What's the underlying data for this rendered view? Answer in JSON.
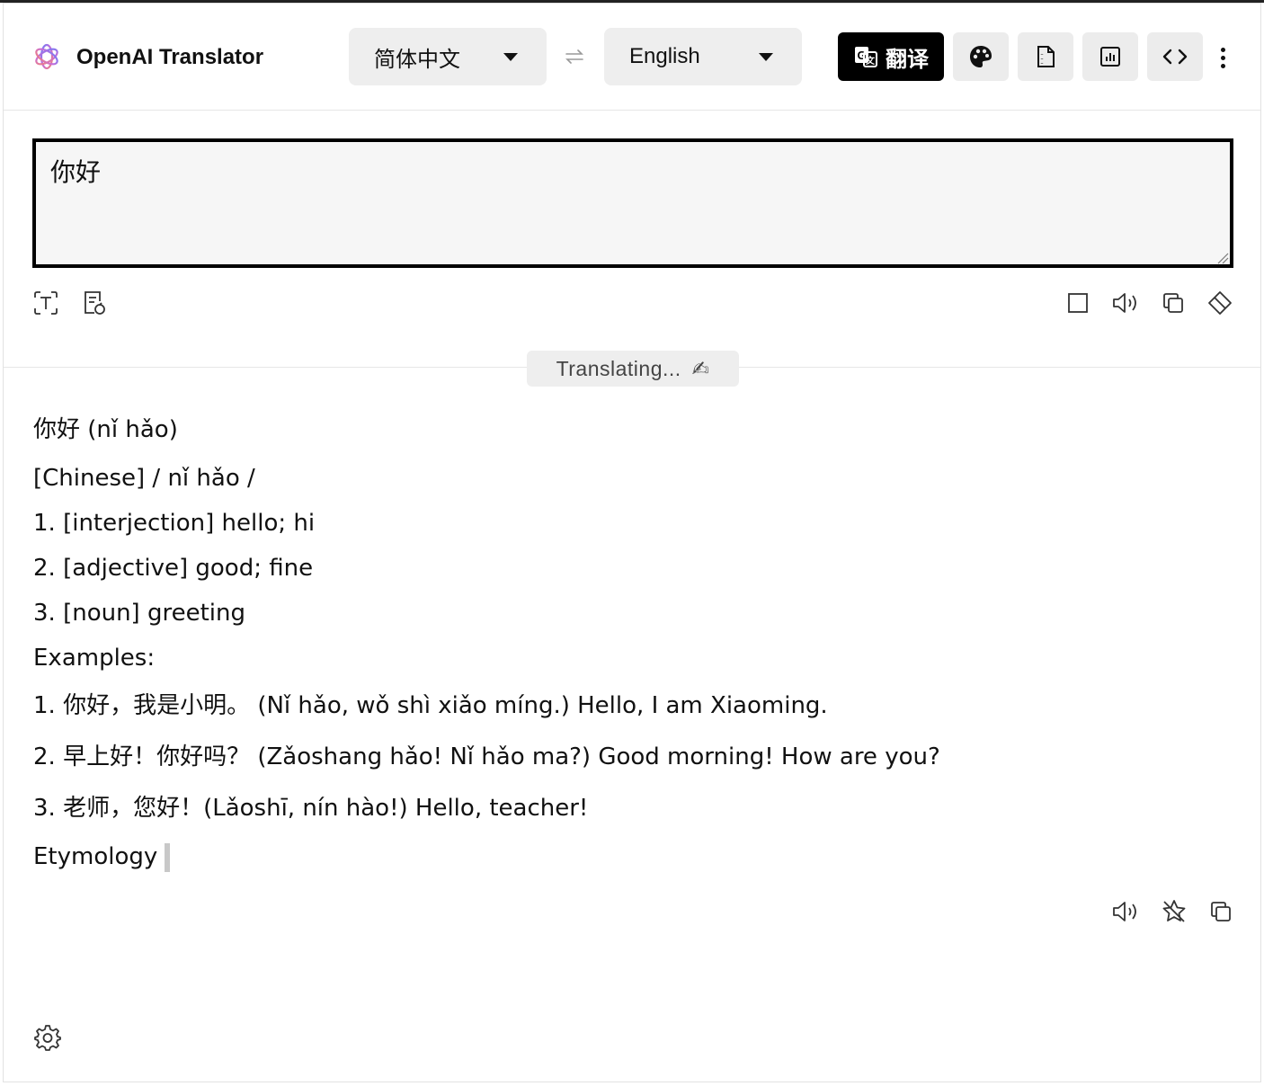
{
  "app": {
    "title": "OpenAI Translator"
  },
  "header": {
    "source_language": "简体中文",
    "target_language": "English",
    "translate_label": "翻译",
    "icons": [
      "openai-logo-icon",
      "swap-icon",
      "translate-icon",
      "palette-icon",
      "document-icon",
      "chart-icon",
      "code-icon",
      "more-vertical-icon"
    ]
  },
  "input": {
    "value": "你好",
    "toolbar_left_icons": [
      "text-recognition-icon",
      "file-refresh-icon"
    ],
    "toolbar_right_icons": [
      "stop-icon",
      "speaker-icon",
      "copy-icon",
      "eraser-icon"
    ]
  },
  "status": {
    "text": "Translating...",
    "emoji": "✍"
  },
  "output": {
    "lines": [
      "你好 (nǐ hǎo)",
      "[Chinese] / nǐ hǎo /",
      "1. [interjection] hello; hi",
      "2. [adjective] good; fine",
      "3. [noun] greeting",
      "Examples:",
      "1. 你好，我是小明。 (Nǐ hǎo, wǒ shì xiǎo míng.) Hello, I am Xiaoming.",
      "2. 早上好！你好吗？ (Zǎoshang hǎo! Nǐ hǎo ma?) Good morning! How are you?",
      "3. 老师，您好！(Lǎoshī, nín hào!) Hello, teacher!",
      "Etymology"
    ],
    "toolbar_icons": [
      "speaker-icon",
      "star-off-icon",
      "copy-icon"
    ]
  },
  "footer": {
    "icons": [
      "settings-gear-icon"
    ]
  }
}
